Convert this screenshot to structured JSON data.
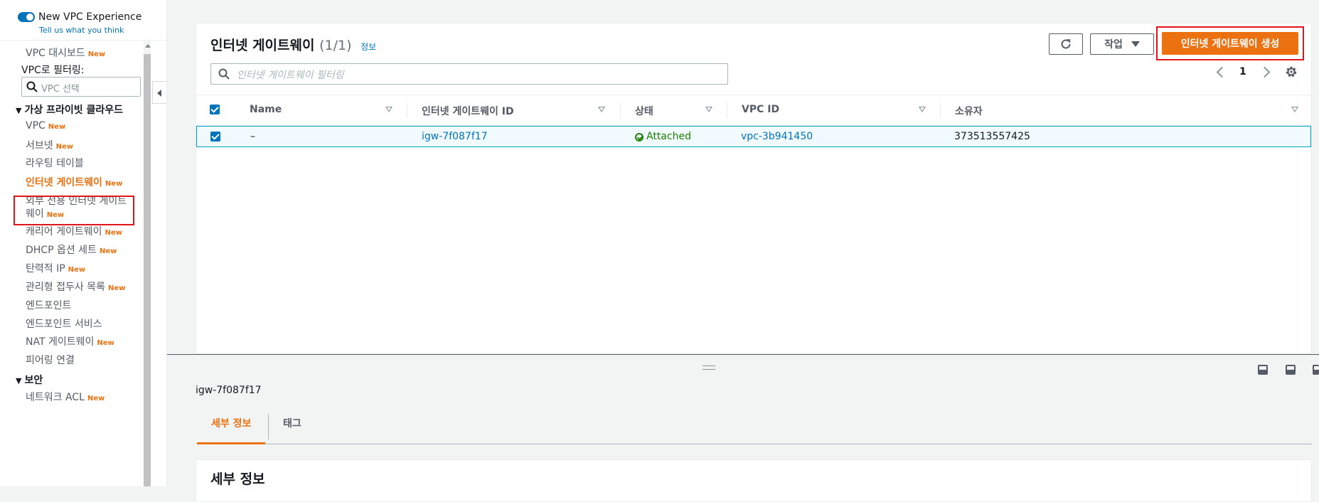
{
  "experience": {
    "title": "New VPC Experience",
    "feedback_link": "Tell us what you think"
  },
  "sidebar": {
    "dashboard": "VPC 대시보드",
    "new_badge": "New",
    "filter_label": "VPC로 필터링:",
    "filter_placeholder": "VPC 선택",
    "section_vpc": "가상 프라이빗 클라우드",
    "items": [
      {
        "label": "VPC",
        "new": "New"
      },
      {
        "label": "서브넷",
        "new": "New"
      },
      {
        "label": "라우팅 테이블",
        "new": ""
      },
      {
        "label": "인터넷 게이트웨이",
        "new": "New"
      },
      {
        "label": "외부 전용 인터넷 게이트",
        "new": ""
      },
      {
        "label": "웨이",
        "new": "New"
      },
      {
        "label": "캐리어 게이트웨이",
        "new": "New"
      },
      {
        "label": "DHCP 옵션 세트",
        "new": "New"
      },
      {
        "label": "탄력적 IP",
        "new": "New"
      },
      {
        "label": "관리형 접두사 목록",
        "new": "New"
      },
      {
        "label": "엔드포인트",
        "new": ""
      },
      {
        "label": "엔드포인트 서비스",
        "new": ""
      },
      {
        "label": "NAT 게이트웨이",
        "new": "New"
      },
      {
        "label": "피어링 연결",
        "new": ""
      }
    ],
    "section_security": "보안",
    "security_items": [
      {
        "label": "네트워크 ACL",
        "new": "New"
      }
    ]
  },
  "panel": {
    "title": "인터넷 게이트웨이",
    "count": "(1/1)",
    "info": "정보",
    "actions_label": "작업",
    "create_label": "인터넷 게이트웨이 생성",
    "filter_placeholder": "인터넷 게이트웨이 필터링",
    "page": "1"
  },
  "table": {
    "columns": [
      "Name",
      "인터넷 게이트웨이 ID",
      "상태",
      "VPC ID",
      "소유자"
    ],
    "rows": [
      {
        "name": "–",
        "id": "igw-7f087f17",
        "state": "Attached",
        "vpc": "vpc-3b941450",
        "owner": "373513557425"
      }
    ]
  },
  "details": {
    "selected_id": "igw-7f087f17",
    "tabs": [
      "세부 정보",
      "태그"
    ],
    "heading": "세부 정보"
  },
  "colors": {
    "accent": "#ec7211",
    "link": "#0073bb",
    "success": "#1d8102",
    "highlight_border": "#e0161c"
  }
}
